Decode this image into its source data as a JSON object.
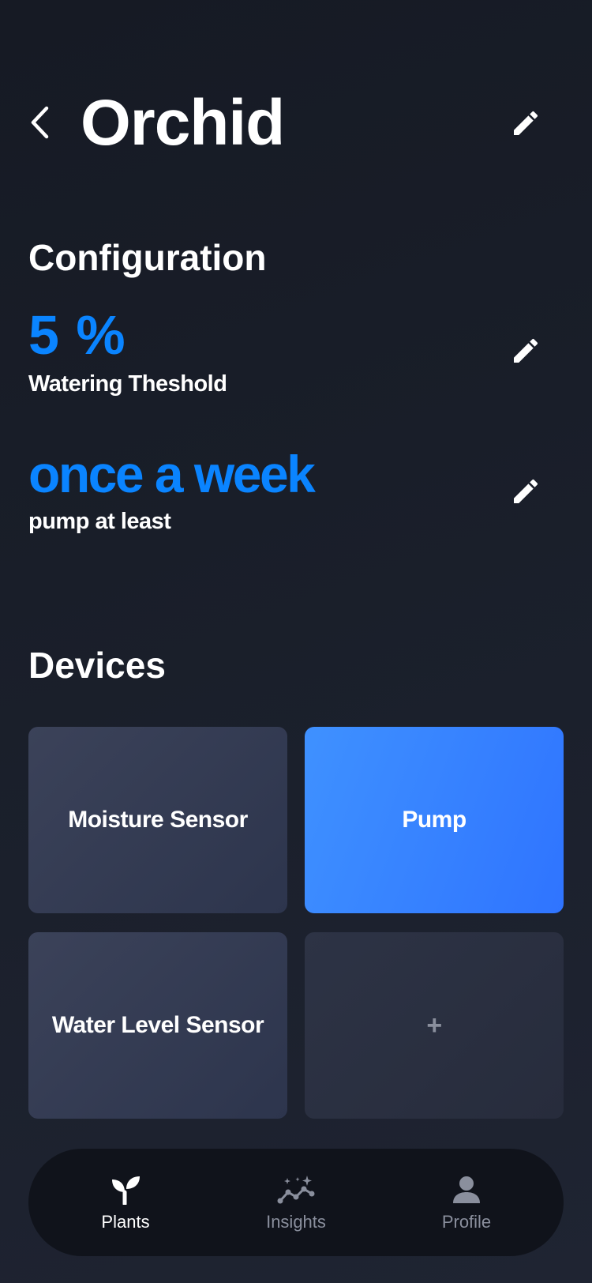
{
  "header": {
    "title": "Orchid",
    "back_icon": "chevron-left-icon",
    "edit_icon": "pencil-icon"
  },
  "configuration": {
    "title": "Configuration",
    "threshold": {
      "value": "5 %",
      "label": "Watering Theshold"
    },
    "frequency": {
      "value": "once a week",
      "label": "pump at least"
    }
  },
  "devices": {
    "title": "Devices",
    "tiles": [
      {
        "label": "Moisture Sensor",
        "active": false
      },
      {
        "label": "Pump",
        "active": true
      },
      {
        "label": "Water Level Sensor",
        "active": false
      },
      {
        "label": "+",
        "active": false
      }
    ]
  },
  "tab_bar": {
    "tabs": [
      {
        "label": "Plants",
        "icon": "sprout-icon",
        "active": true
      },
      {
        "label": "Insights",
        "icon": "sparkle-chart-icon",
        "active": false
      },
      {
        "label": "Profile",
        "icon": "person-icon",
        "active": false
      }
    ]
  },
  "colors": {
    "accent": "#0a84ff",
    "active_tile": "#3a86ff",
    "active_tab_label": "#ffffff",
    "inactive_tab_label": "#8a8f9d"
  }
}
